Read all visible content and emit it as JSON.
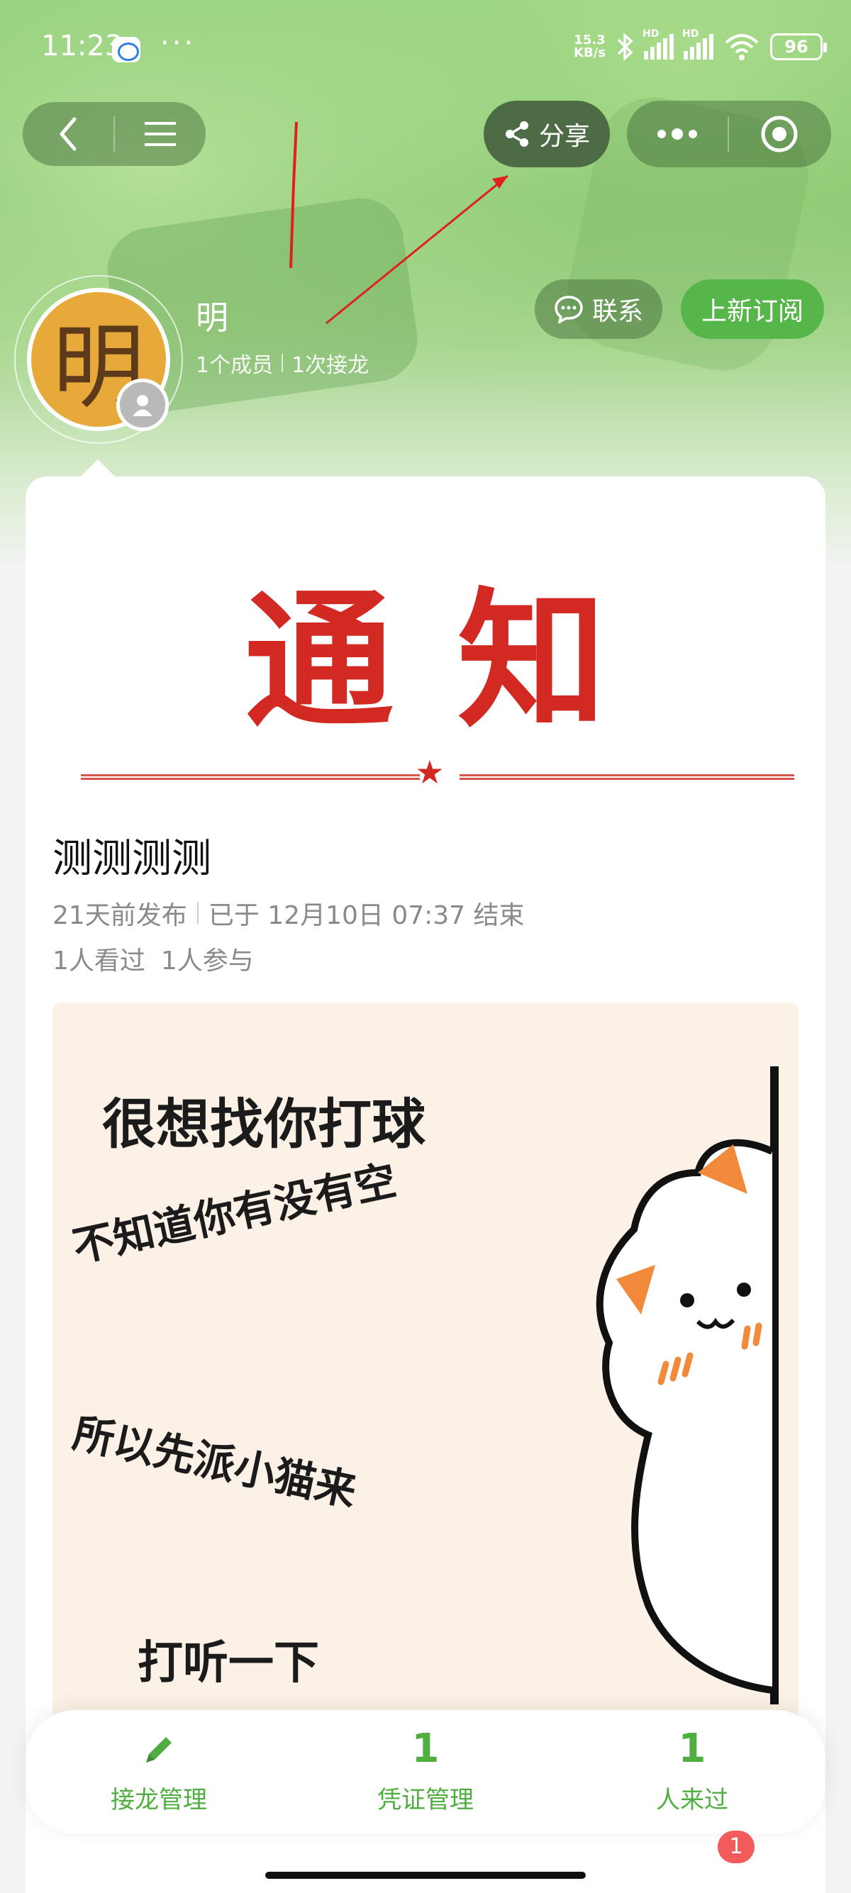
{
  "status_bar": {
    "time": "11:23",
    "dots": "···",
    "net_speed_value": "15.3",
    "net_speed_unit": "KB/s",
    "hd_label": "HD",
    "battery": "96"
  },
  "nav": {
    "share_label": "分享"
  },
  "profile": {
    "avatar_char": "明",
    "name": "明",
    "members": "1个成员",
    "relays": "1次接龙",
    "contact_label": "联系",
    "subscribe_label": "上新订阅"
  },
  "post": {
    "banner_title": "通知",
    "star": "★",
    "title": "测测测测",
    "published": "21天前发布",
    "ended": "已于 12月10日 07:37 结束",
    "views": "1人看过",
    "participants": "1人参与",
    "meme_lines": [
      "很想找你打球",
      "不知道你有没有空",
      "所以先派小猫来",
      "打听一下"
    ]
  },
  "action_bar": {
    "items": [
      {
        "value": "",
        "label": "接龙管理"
      },
      {
        "value": "1",
        "label": "凭证管理"
      },
      {
        "value": "1",
        "label": "人来过"
      }
    ]
  },
  "notifications": {
    "badge": "1"
  },
  "colors": {
    "accent_green": "#4fae3f",
    "notice_red": "#d22a22"
  }
}
